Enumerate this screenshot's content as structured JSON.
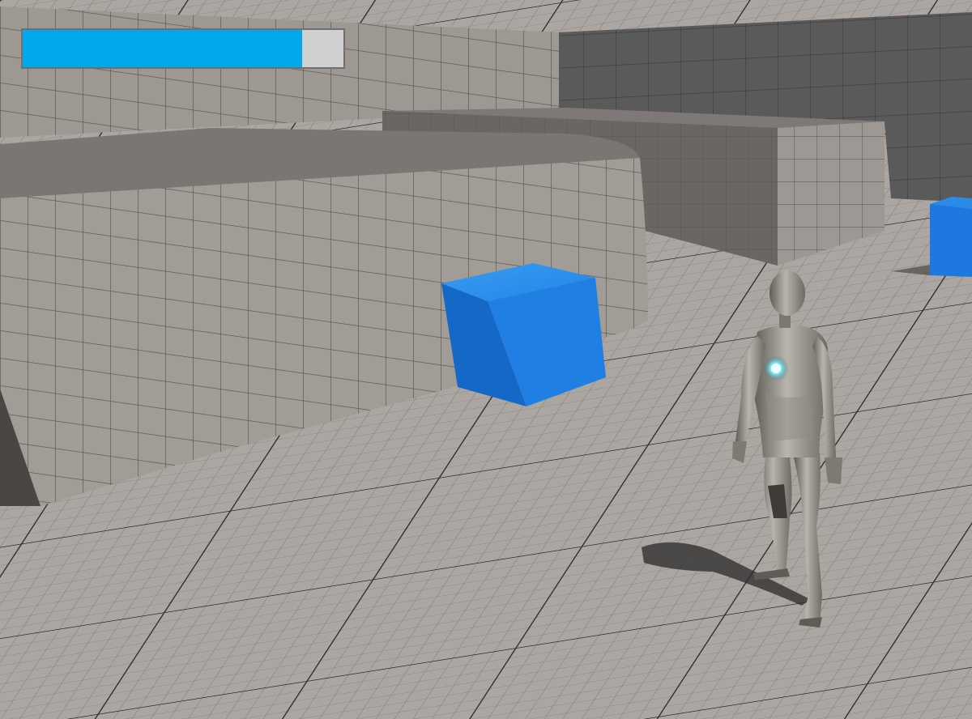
{
  "hud": {
    "health_bar": {
      "fill_fraction": 0.87,
      "fill_color": "#00a9ec",
      "empty_color": "#cfcfcf"
    }
  },
  "scene": {
    "sky_color": "#bcd3ea",
    "floor_color": "#aca6a3",
    "wall_color": "#9d9792",
    "dark_wall_color": "#595858",
    "cube_color": "#1f80e6",
    "character": "mannequin-character"
  }
}
